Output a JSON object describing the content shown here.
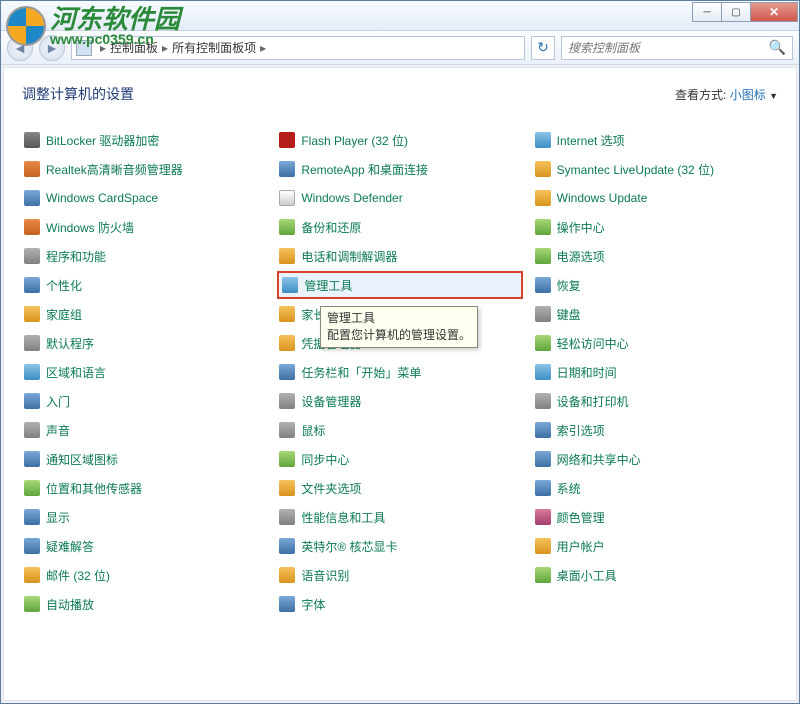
{
  "watermark": {
    "cn": "河东软件园",
    "url": "www.pc0359.cn"
  },
  "breadcrumb": {
    "root": "控制面板",
    "current": "所有控制面板项"
  },
  "search": {
    "placeholder": "搜索控制面板"
  },
  "heading": "调整计算机的设置",
  "viewmode": {
    "label": "查看方式:",
    "value": "小图标"
  },
  "highlighted_index": 16,
  "tooltip": {
    "title": "管理工具",
    "desc": "配置您计算机的管理设置。"
  },
  "items": [
    {
      "label": "BitLocker 驱动器加密",
      "ic": "ic4"
    },
    {
      "label": "Flash Player (32 位)",
      "ic": "ic9"
    },
    {
      "label": "Internet 选项",
      "ic": "ic6"
    },
    {
      "label": "Realtek高清晰音频管理器",
      "ic": "ic7"
    },
    {
      "label": "RemoteApp 和桌面连接",
      "ic": "ic1"
    },
    {
      "label": "Symantec LiveUpdate (32 位)",
      "ic": "ic2"
    },
    {
      "label": "Windows CardSpace",
      "ic": "ic1"
    },
    {
      "label": "Windows Defender",
      "ic": "ic10"
    },
    {
      "label": "Windows Update",
      "ic": "ic2"
    },
    {
      "label": "Windows 防火墙",
      "ic": "ic7"
    },
    {
      "label": "备份和还原",
      "ic": "ic3"
    },
    {
      "label": "操作中心",
      "ic": "ic3"
    },
    {
      "label": "程序和功能",
      "ic": "ic8"
    },
    {
      "label": "电话和调制解调器",
      "ic": "ic2"
    },
    {
      "label": "电源选项",
      "ic": "ic3"
    },
    {
      "label": "个性化",
      "ic": "ic1"
    },
    {
      "label": "管理工具",
      "ic": "ic6"
    },
    {
      "label": "恢复",
      "ic": "ic1"
    },
    {
      "label": "家庭组",
      "ic": "ic2"
    },
    {
      "label": "家长控制",
      "ic": "ic2"
    },
    {
      "label": "键盘",
      "ic": "ic8"
    },
    {
      "label": "默认程序",
      "ic": "ic8"
    },
    {
      "label": "凭据管理器",
      "ic": "ic2"
    },
    {
      "label": "轻松访问中心",
      "ic": "ic3"
    },
    {
      "label": "区域和语言",
      "ic": "ic6"
    },
    {
      "label": "任务栏和「开始」菜单",
      "ic": "ic1"
    },
    {
      "label": "日期和时间",
      "ic": "ic6"
    },
    {
      "label": "入门",
      "ic": "ic1"
    },
    {
      "label": "设备管理器",
      "ic": "ic8"
    },
    {
      "label": "设备和打印机",
      "ic": "ic8"
    },
    {
      "label": "声音",
      "ic": "ic8"
    },
    {
      "label": "鼠标",
      "ic": "ic8"
    },
    {
      "label": "索引选项",
      "ic": "ic1"
    },
    {
      "label": "通知区域图标",
      "ic": "ic1"
    },
    {
      "label": "同步中心",
      "ic": "ic3"
    },
    {
      "label": "网络和共享中心",
      "ic": "ic1"
    },
    {
      "label": "位置和其他传感器",
      "ic": "ic3"
    },
    {
      "label": "文件夹选项",
      "ic": "ic2"
    },
    {
      "label": "系统",
      "ic": "ic1"
    },
    {
      "label": "显示",
      "ic": "ic1"
    },
    {
      "label": "性能信息和工具",
      "ic": "ic8"
    },
    {
      "label": "颜色管理",
      "ic": "ic5"
    },
    {
      "label": "疑难解答",
      "ic": "ic1"
    },
    {
      "label": "英特尔® 核芯显卡",
      "ic": "ic1"
    },
    {
      "label": "用户帐户",
      "ic": "ic2"
    },
    {
      "label": "邮件 (32 位)",
      "ic": "ic2"
    },
    {
      "label": "语音识别",
      "ic": "ic2"
    },
    {
      "label": "桌面小工具",
      "ic": "ic3"
    },
    {
      "label": "自动播放",
      "ic": "ic3"
    },
    {
      "label": "字体",
      "ic": "ic1"
    }
  ]
}
